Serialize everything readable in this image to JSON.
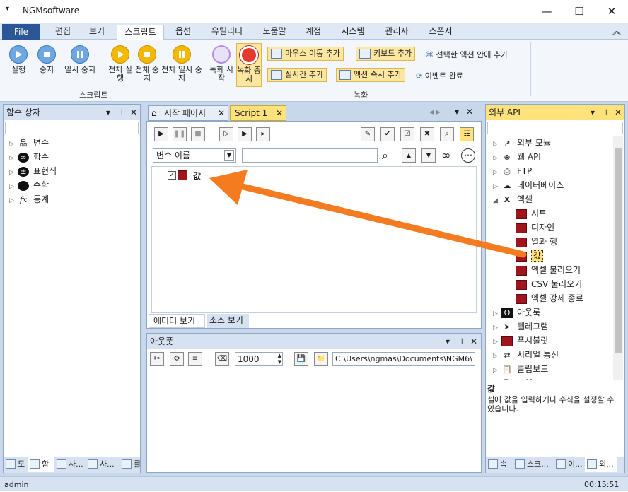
{
  "window": {
    "title": "NGMsoftware",
    "min": "—",
    "max": "☐",
    "close": "✕",
    "menu_glyph": "▾"
  },
  "menu": {
    "file": "File",
    "items": [
      "편집",
      "보기",
      "스크립트",
      "옵션",
      "유틸리티",
      "도움말",
      "계정",
      "시스템",
      "관리자",
      "스폰서"
    ],
    "collapse": "︽"
  },
  "ribbon": {
    "script_group": "스크립트",
    "record_group": "녹화",
    "run": "실행",
    "stop": "중지",
    "pause": "일시 중지",
    "run_all": "전체 실행",
    "stop_all": "전체 중지",
    "pause_all": "전체 일시 중지",
    "rec_start": "녹화 시작",
    "rec_stop": "녹화 중지",
    "add_mouse": "마우스 이동 추가",
    "add_keyboard": "키보드 추가",
    "add_in_action": "선택한 액션 안에 추가",
    "add_realtime": "실시간 추가",
    "add_action_now": "액션 즉시 추가",
    "event_done": "이벤트 완료"
  },
  "left": {
    "title": "함수 상자",
    "items": [
      "변수",
      "함수",
      "표현식",
      "수학",
      "통계"
    ],
    "tabs": [
      "도",
      "함",
      "사...",
      "사...",
      "를"
    ]
  },
  "editor": {
    "tabs": [
      "시작 페이지",
      "Script 1"
    ],
    "var_select": "변수 이름",
    "node": "값",
    "bottom_tabs": [
      "에디터 보기",
      "소스 보기"
    ]
  },
  "output": {
    "title": "아웃풋",
    "delay": "1000",
    "path": "C:\\Users\\ngmas\\Documents\\NGM6\\"
  },
  "right": {
    "title": "외부 API",
    "items": [
      "외부 모듈",
      "웹 API",
      "FTP",
      "데이터베이스",
      "엑셀",
      "시트",
      "디자인",
      "열과 행",
      "값",
      "엑셀 불러오기",
      "CSV 불러오기",
      "엑셀 강제 종료",
      "아웃룩",
      "텔레그램",
      "푸시불릿",
      "시리얼 통신",
      "클립보드",
      "파일"
    ],
    "desc_title": "값",
    "desc": "셀에 값을 입력하거나 수식을 설정할 수 있습니다.",
    "tabs": [
      "속",
      "스크...",
      "이...",
      "외..."
    ]
  },
  "status": {
    "user": "admin",
    "time": "00:15:51"
  },
  "colors": {
    "accent": "#2b5797",
    "highlight": "#ffe27a",
    "arrow": "#f47b20"
  }
}
